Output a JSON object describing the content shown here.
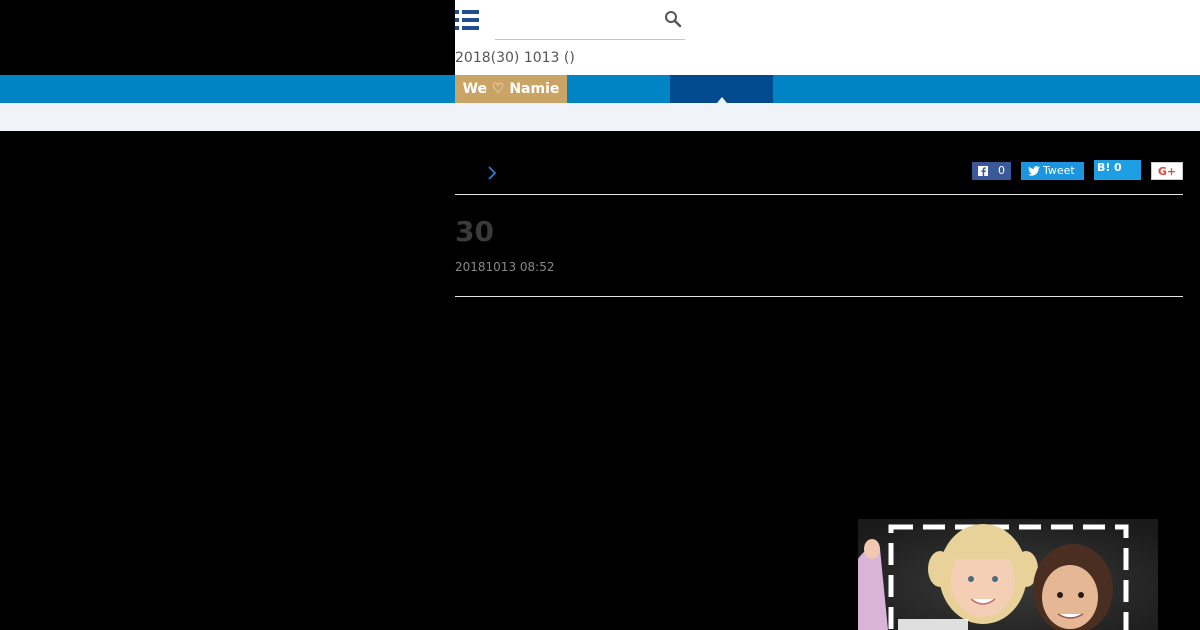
{
  "header": {
    "search_placeholder": "",
    "headline": "2018(30) 1013 ()"
  },
  "nav": {
    "brand_label": "We ♡ Namie"
  },
  "share": {
    "facebook_count": "0",
    "tweet_label": "Tweet",
    "hatena_mark": "B!",
    "hatena_count": "0",
    "google_label": "G+"
  },
  "article": {
    "title": "30",
    "date": "20181013 08:52"
  },
  "colors": {
    "nav_blue": "#0084c3",
    "nav_active": "#004a8d",
    "brand_gold": "#c9a464",
    "subbar": "#f0f3f7"
  }
}
